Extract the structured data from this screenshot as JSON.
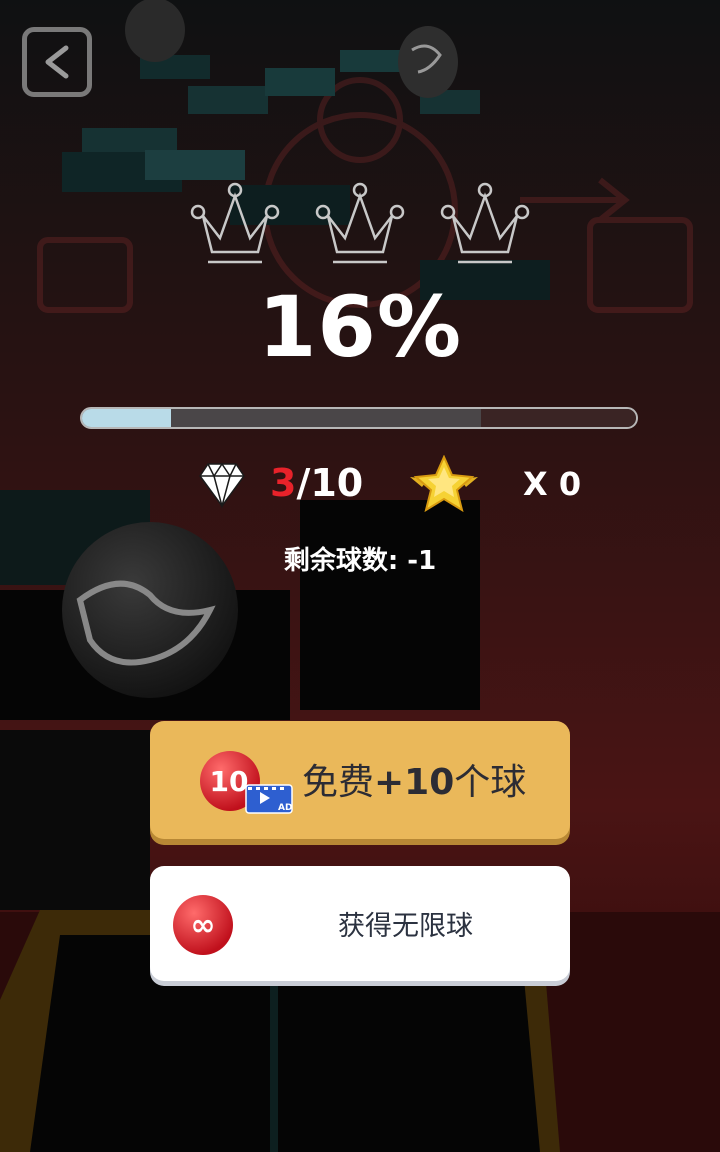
{
  "level": {
    "progress_text": "16%",
    "progress_fraction": 0.16,
    "crowns_earned": 0,
    "crowns_total": 3
  },
  "stats": {
    "gems_current": "3",
    "gems_total": "/10",
    "stars_text": "X 0"
  },
  "remaining_balls": "剩余球数: -1",
  "buttons": {
    "free_prefix": "免费",
    "free_amount": "+10",
    "free_suffix": "个球",
    "free_badge": "10",
    "free_ad_label": "AD",
    "unlimited_label": "获得无限球",
    "unlimited_symbol": "∞"
  },
  "colors": {
    "primary_button": "#eab85a",
    "progress_fill": "#b9dbe8",
    "gem_highlight": "#e8222a"
  },
  "icons": [
    "back-arrow-icon",
    "crown-outline-icon",
    "diamond-icon",
    "star-icon",
    "video-ad-icon",
    "infinity-icon"
  ]
}
